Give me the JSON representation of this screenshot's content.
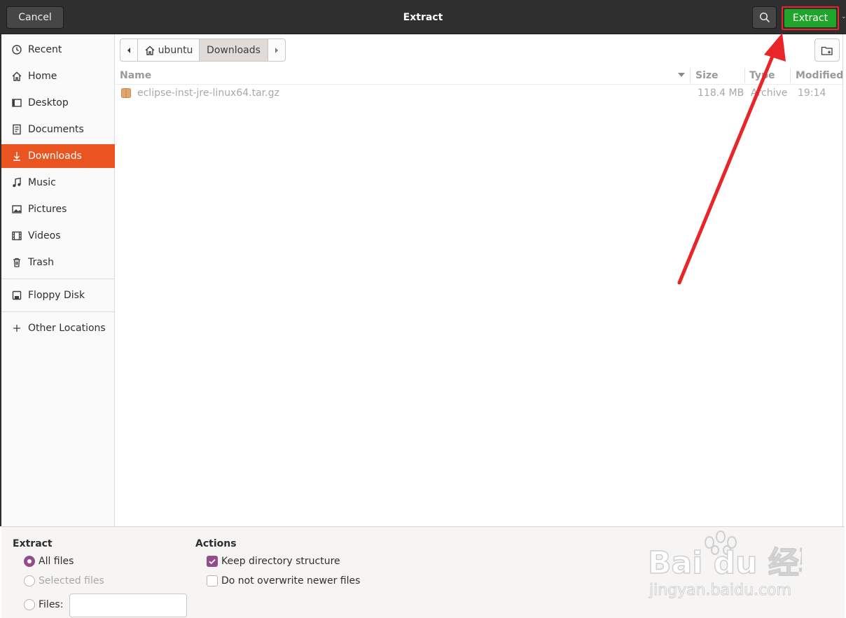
{
  "header": {
    "title": "Extract",
    "cancel_label": "Cancel",
    "extract_label": "Extract",
    "search_icon": "search-icon",
    "accent_color": "#1ea52a",
    "highlight_color": "#e8262a"
  },
  "sidebar": {
    "items": [
      {
        "label": "Recent",
        "icon": "clock-icon"
      },
      {
        "label": "Home",
        "icon": "home-icon"
      },
      {
        "label": "Desktop",
        "icon": "desktop-icon"
      },
      {
        "label": "Documents",
        "icon": "document-icon"
      },
      {
        "label": "Downloads",
        "icon": "download-icon",
        "active": true
      },
      {
        "label": "Music",
        "icon": "music-icon"
      },
      {
        "label": "Pictures",
        "icon": "picture-icon"
      },
      {
        "label": "Videos",
        "icon": "video-icon"
      },
      {
        "label": "Trash",
        "icon": "trash-icon"
      }
    ],
    "devices": [
      {
        "label": "Floppy Disk",
        "icon": "drive-icon"
      }
    ],
    "other": {
      "label": "Other Locations",
      "icon": "plus-icon"
    },
    "active_color": "#e95420"
  },
  "pathbar": {
    "segments": [
      "ubuntu",
      "Downloads"
    ],
    "current": "Downloads"
  },
  "file_list": {
    "columns": {
      "name": "Name",
      "size": "Size",
      "type": "Type",
      "modified": "Modified"
    },
    "rows": [
      {
        "name": "eclipse-inst-jre-linux64.tar.gz",
        "size": "118.4 MB",
        "type": "Archive",
        "modified": "19:14"
      }
    ]
  },
  "options": {
    "extract_title": "Extract",
    "all_files": "All files",
    "selected_files": "Selected files",
    "files_label": "Files:",
    "files_value": "",
    "actions_title": "Actions",
    "keep_structure": "Keep directory structure",
    "no_overwrite": "Do not overwrite newer files",
    "checked_color": "#924d8b"
  },
  "watermark": {
    "text": "Bai du 经验",
    "subtext": "jingyan.baidu.com"
  }
}
